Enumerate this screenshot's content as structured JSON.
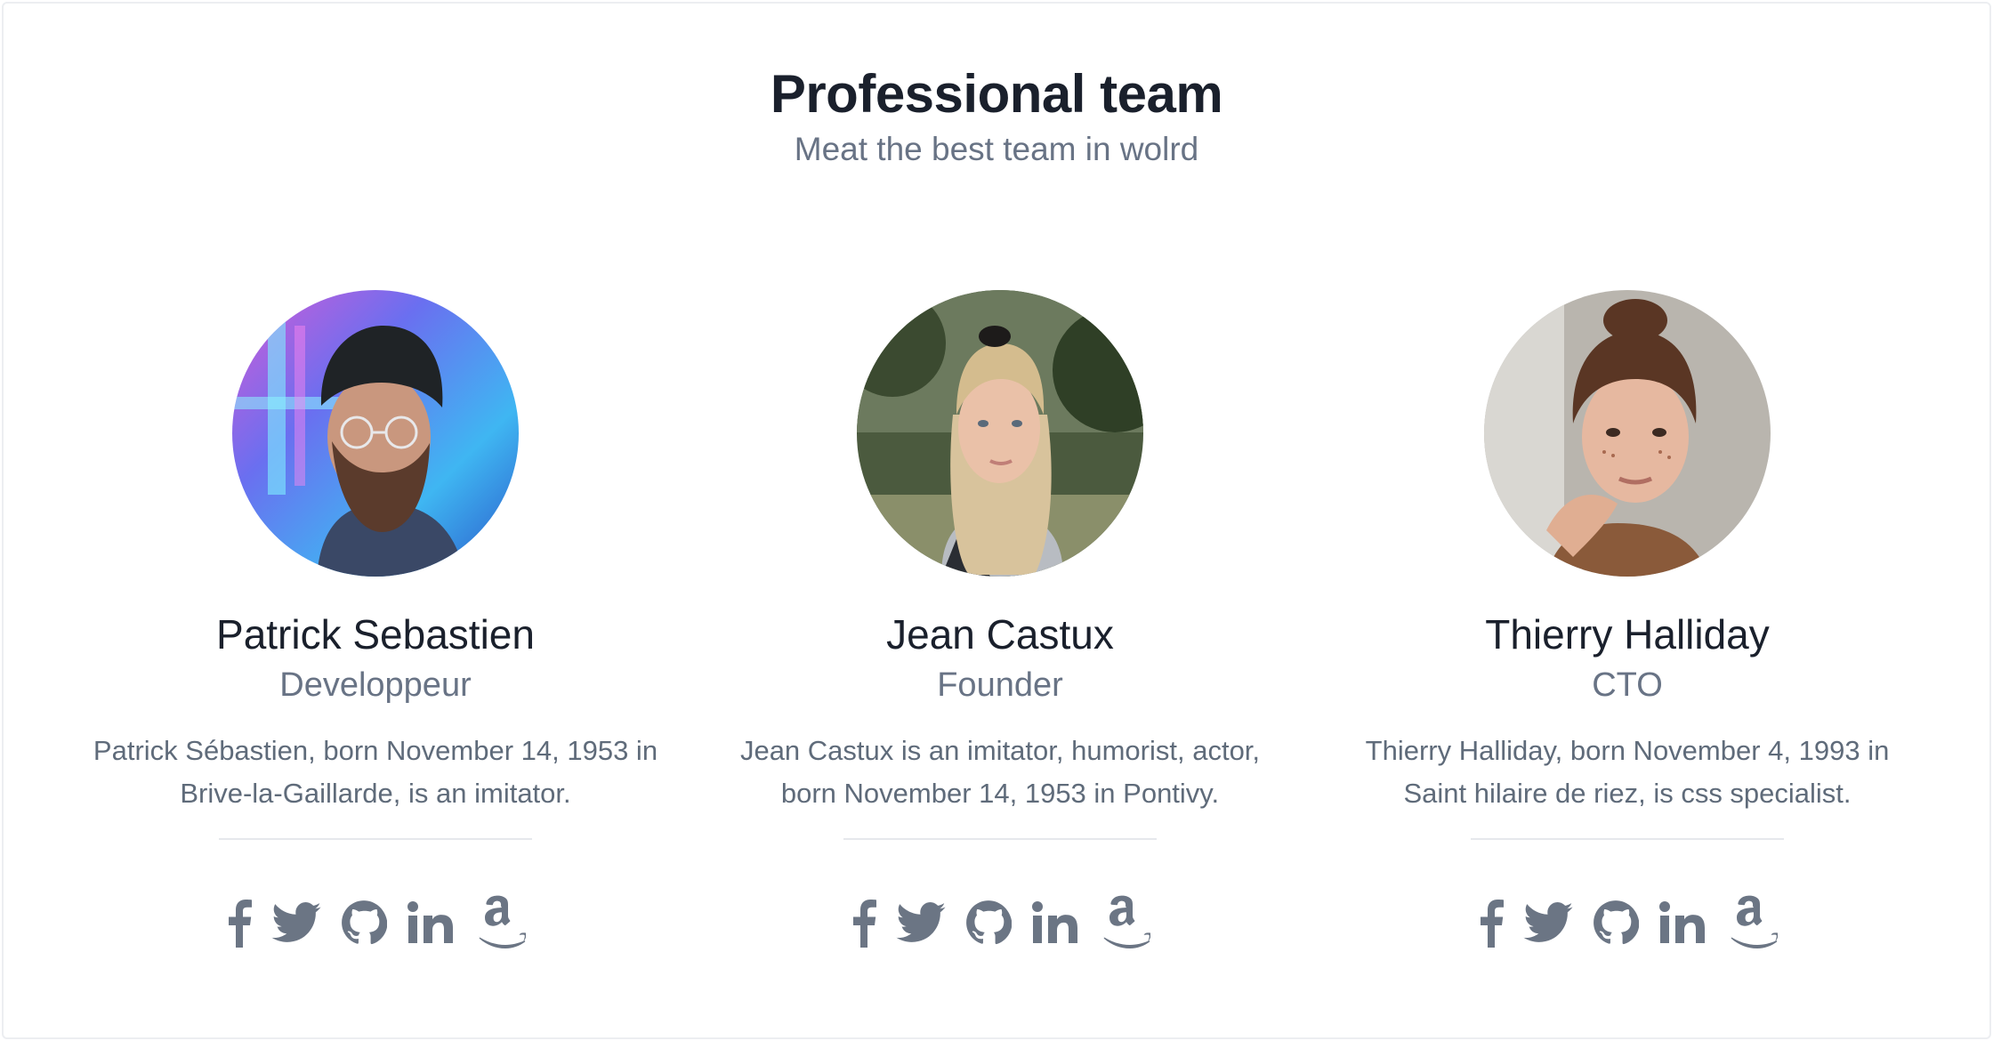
{
  "header": {
    "title": "Professional team",
    "subtitle": "Meat the best team in wolrd"
  },
  "members": [
    {
      "name": "Patrick Sebastien",
      "role": "Developpeur",
      "bio": "Patrick Sébastien, born November 14, 1953 in Brive-la-Gaillarde, is an imitator.",
      "avatar": "photo-man-beanie-glasses"
    },
    {
      "name": "Jean Castux",
      "role": "Founder",
      "bio": "Jean Castux is an imitator, humorist, actor, born November 14, 1953 in Pontivy.",
      "avatar": "photo-woman-blonde-ponytail"
    },
    {
      "name": "Thierry Halliday",
      "role": "CTO",
      "bio": "Thierry Halliday, born November 4, 1993 in Saint hilaire de riez, is css specialist.",
      "avatar": "photo-woman-freckles-bun"
    }
  ],
  "social_icons": [
    "facebook-icon",
    "twitter-icon",
    "github-icon",
    "linkedin-icon",
    "amazon-icon"
  ],
  "colors": {
    "heading": "#1a202c",
    "muted": "#687385",
    "icon": "#6b7584",
    "divider": "#e6e8ec"
  }
}
